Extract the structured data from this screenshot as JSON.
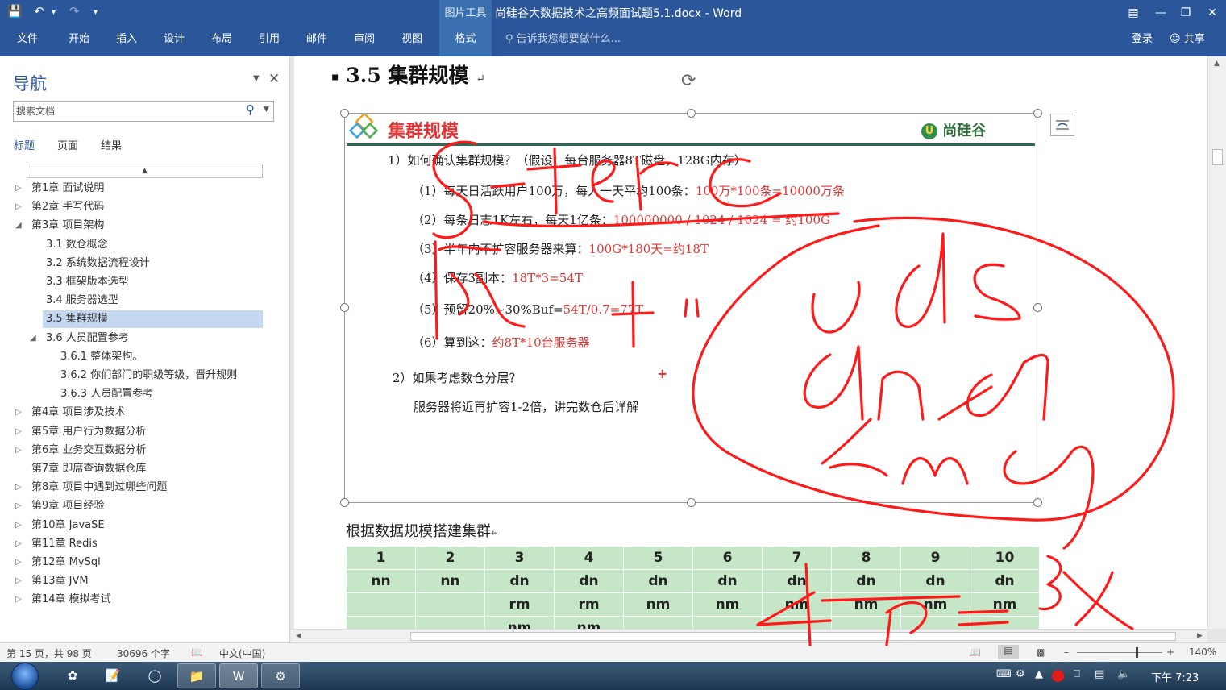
{
  "titlebar": {
    "context_tab": "图片工具",
    "document_title": "尚硅谷大数据技术之高频面试题5.1.docx - Word",
    "quick_access": [
      "save",
      "undo",
      "redo",
      "customize"
    ]
  },
  "ribbon": {
    "tabs": [
      "文件",
      "开始",
      "插入",
      "设计",
      "布局",
      "引用",
      "邮件",
      "审阅",
      "视图",
      "格式"
    ],
    "active_tab": "格式",
    "tell_me": "告诉我您想要做什么...",
    "login": "登录",
    "share": "共享"
  },
  "nav": {
    "title": "导航",
    "search_placeholder": "搜索文档",
    "tabs": [
      "标题",
      "页面",
      "结果"
    ],
    "active_tab": "标题",
    "collapse_glyph": "▲",
    "items": [
      {
        "label": "第1章 面试说明"
      },
      {
        "label": "第2章 手写代码"
      },
      {
        "label": "第3章 项目架构"
      },
      {
        "label": "3.1 数仓概念"
      },
      {
        "label": "3.2 系统数据流程设计"
      },
      {
        "label": "3.3 框架版本选型"
      },
      {
        "label": "3.4 服务器选型"
      },
      {
        "label": "3.5 集群规模"
      },
      {
        "label": "3.6 人员配置参考"
      },
      {
        "label": "3.6.1 整体架构。"
      },
      {
        "label": "3.6.2 你们部门的职级等级，晋升规则"
      },
      {
        "label": "3.6.3 人员配置参考"
      },
      {
        "label": "第4章 项目涉及技术"
      },
      {
        "label": "第5章 用户行为数据分析"
      },
      {
        "label": "第6章 业务交互数据分析"
      },
      {
        "label": "第7章 即席查询数据仓库"
      },
      {
        "label": "第8章 项目中遇到过哪些问题"
      },
      {
        "label": "第9章 项目经验"
      },
      {
        "label": "第10章 JavaSE"
      },
      {
        "label": "第11章 Redis"
      },
      {
        "label": "第12章 MySql"
      },
      {
        "label": "第13章 JVM"
      },
      {
        "label": "第14章 模拟考试"
      }
    ],
    "selected": "3.5 集群规模"
  },
  "document": {
    "heading": "3.5  集群规模",
    "slide": {
      "title": "集群规模",
      "logo": "尚硅谷",
      "lines": [
        {
          "text": "1）如何确认集群规模？（假设：每台服务器8T磁盘，128G内存）",
          "red": ""
        },
        {
          "text": "（1）每天日活跃用户100万，每人一天平均100条：",
          "red": "100万*100条=10000万条"
        },
        {
          "text": "（2）每条日志1K左右，每天1亿条：",
          "red": "100000000 / 1024 / 1024 = 约100G"
        },
        {
          "text": "（3）半年内不扩容服务器来算：",
          "red": "100G*180天=约18T"
        },
        {
          "text": "（4）保存3副本：",
          "red": "18T*3=54T"
        },
        {
          "text": "（5）预留20%~30%Buf=",
          "red": "54T/0.7=77T"
        },
        {
          "text": "（6）算到这：",
          "red": "约8T*10台服务器"
        },
        {
          "text": "2）如果考虑数仓分层？",
          "red": ""
        },
        {
          "text": "服务器将近再扩容1-2倍，讲完数仓后详解",
          "red": ""
        }
      ],
      "plus_mark": "+"
    },
    "caption": "根据数据规模搭建集群",
    "table": [
      [
        "1",
        "2",
        "3",
        "4",
        "5",
        "6",
        "7",
        "8",
        "9",
        "10"
      ],
      [
        "nn",
        "nn",
        "dn",
        "dn",
        "dn",
        "dn",
        "dn",
        "dn",
        "dn",
        "dn"
      ],
      [
        "",
        "",
        "rm",
        "rm",
        "nm",
        "nm",
        "nm",
        "nm",
        "nm",
        "nm"
      ],
      [
        "",
        "",
        "nm",
        "nm",
        "",
        "",
        "",
        "",
        "",
        ""
      ]
    ]
  },
  "status": {
    "page": "第 15 页，共 98 页",
    "words": "30696 个字",
    "language": "中文(中国)",
    "zoom": "140%",
    "zoom_level_fraction": 0.7
  },
  "taskbar": {
    "clock": "下午 7:23"
  },
  "colors": {
    "accent": "#2b579a",
    "ink": "#ff1a1a",
    "slide_red": "#e53333",
    "table_green": "#c6e6c8",
    "nav_selected": "#c5d8f1"
  }
}
